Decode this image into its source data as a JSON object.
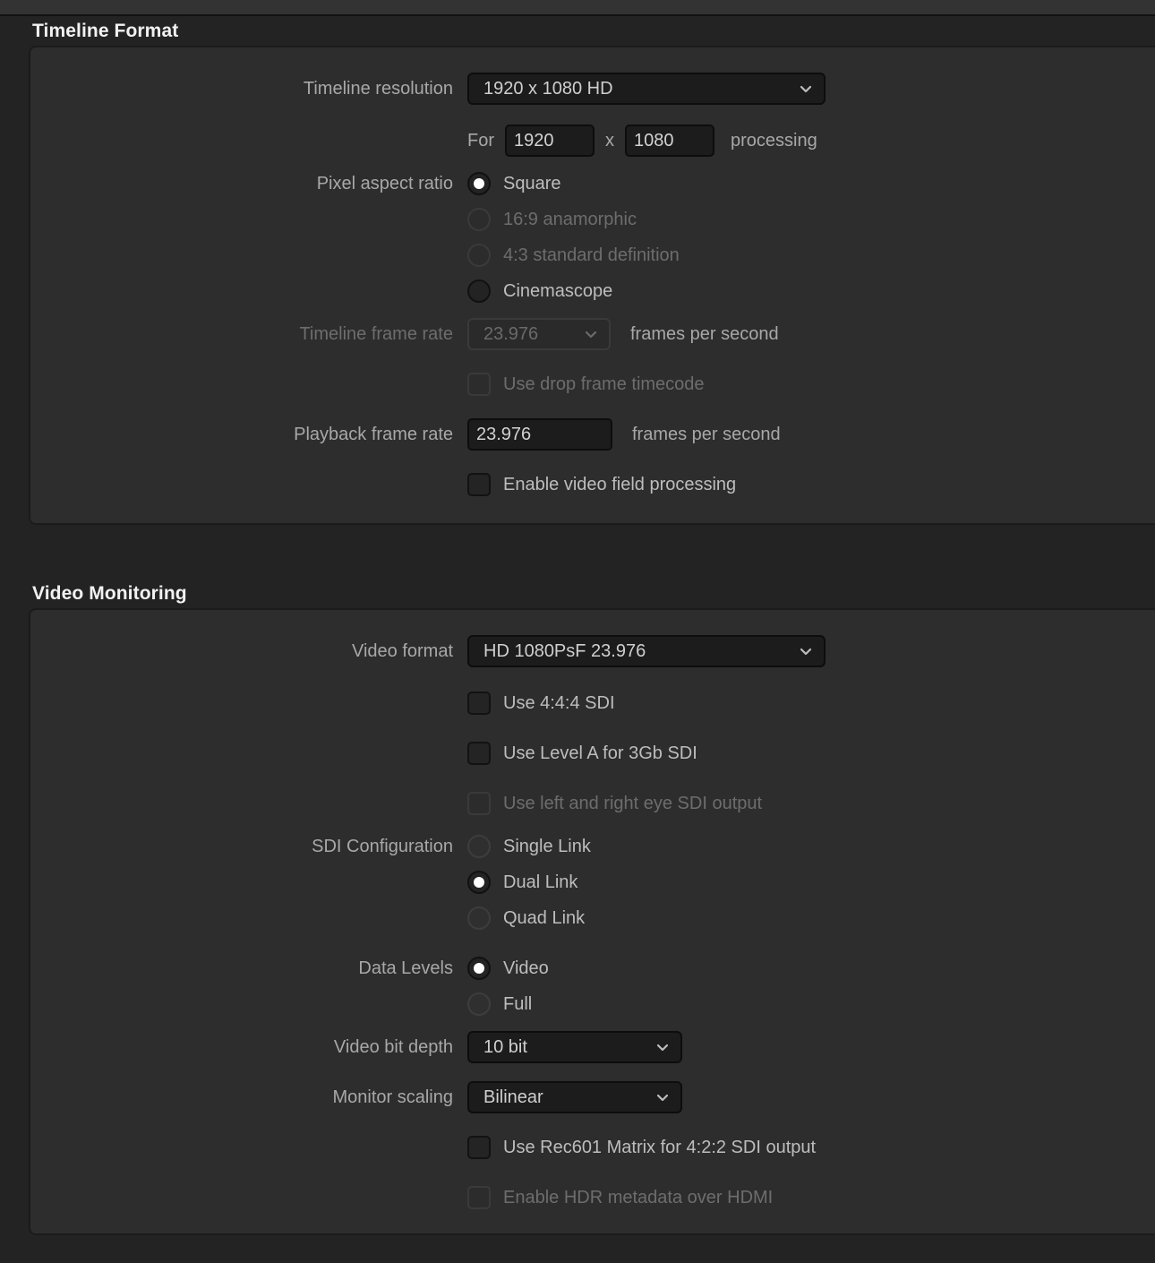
{
  "sections": [
    {
      "title": "Timeline Format",
      "rows": {
        "timeline_resolution_label": "Timeline resolution",
        "timeline_resolution_value": "1920 x 1080 HD",
        "for_prefix": "For",
        "res_width": "1920",
        "res_x": "x",
        "res_height": "1080",
        "processing_suffix": "processing",
        "pixel_aspect_label": "Pixel aspect ratio",
        "pixel_aspect_options": [
          {
            "label": "Square",
            "selected": true,
            "disabled": false
          },
          {
            "label": "16:9 anamorphic",
            "selected": false,
            "disabled": true
          },
          {
            "label": "4:3 standard definition",
            "selected": false,
            "disabled": true
          },
          {
            "label": "Cinemascope",
            "selected": false,
            "disabled": false
          }
        ],
        "timeline_frame_rate_label": "Timeline frame rate",
        "timeline_frame_rate_value": "23.976",
        "timeline_frame_rate_suffix": "frames per second",
        "drop_frame_label": "Use drop frame timecode",
        "playback_frame_rate_label": "Playback frame rate",
        "playback_frame_rate_value": "23.976",
        "playback_frame_rate_suffix": "frames per second",
        "field_processing_label": "Enable video field processing"
      }
    },
    {
      "title": "Video Monitoring",
      "rows": {
        "video_format_label": "Video format",
        "video_format_value": "HD 1080PsF 23.976",
        "use_444_sdi_label": "Use 4:4:4 SDI",
        "use_level_a_label": "Use Level A for 3Gb SDI",
        "use_lr_eye_label": "Use left and right eye SDI output",
        "sdi_configuration_label": "SDI Configuration",
        "sdi_configuration_options": [
          {
            "label": "Single Link",
            "selected": false,
            "disabled": false
          },
          {
            "label": "Dual Link",
            "selected": true,
            "disabled": false
          },
          {
            "label": "Quad Link",
            "selected": false,
            "disabled": false
          }
        ],
        "data_levels_label": "Data Levels",
        "data_levels_options": [
          {
            "label": "Video",
            "selected": true,
            "disabled": false
          },
          {
            "label": "Full",
            "selected": false,
            "disabled": false
          }
        ],
        "video_bit_depth_label": "Video bit depth",
        "video_bit_depth_value": "10 bit",
        "monitor_scaling_label": "Monitor scaling",
        "monitor_scaling_value": "Bilinear",
        "rec601_label": "Use Rec601 Matrix for 4:2:2 SDI output",
        "hdr_metadata_label": "Enable HDR metadata over HDMI"
      }
    }
  ],
  "colors": {
    "window_bg": "#232323",
    "panel_bg": "#2d2d2d",
    "field_bg": "#1c1c1c",
    "label_text": "#a8a8a8",
    "value_text": "#cfcfcf",
    "disabled_text": "#6d6d6d",
    "title_text": "#f2f2f2"
  }
}
